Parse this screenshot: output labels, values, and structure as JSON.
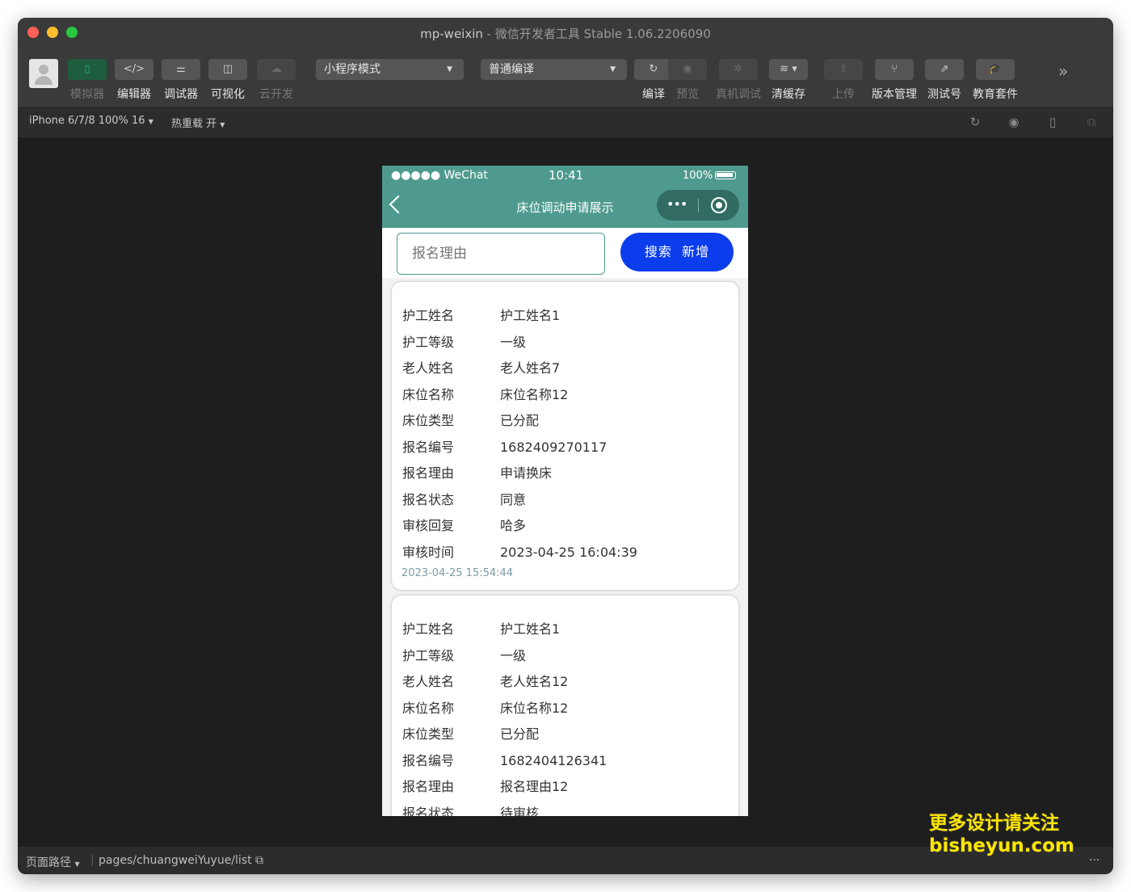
{
  "window": {
    "title_app": "mp-weixin",
    "title_rest": " - 微信开发者工具 Stable 1.06.2206090"
  },
  "toolbar": {
    "simulator": "模拟器",
    "editor": "编辑器",
    "debugger": "调试器",
    "visual": "可视化",
    "cloud": "云开发",
    "mode_select": "小程序模式",
    "compile_select": "普通编译",
    "compile": "编译",
    "preview": "预览",
    "device_debug": "真机调试",
    "clear_cache": "清缓存",
    "upload": "上传",
    "version": "版本管理",
    "test_account": "测试号",
    "edu": "教育套件"
  },
  "subbar": {
    "device": "iPhone 6/7/8 100% 16",
    "hot_reload": "热重载 开"
  },
  "phone": {
    "status_signal": "●●●●● WeChat",
    "status_time": "10:41",
    "status_battery": "100%",
    "nav_title": "床位调动申请展示",
    "capsule_dots": "•••",
    "search_placeholder": "报名理由",
    "search_label": "搜索",
    "add_label": "新增"
  },
  "cards": [
    {
      "rows": [
        {
          "k": "护工姓名",
          "v": "护工姓名1"
        },
        {
          "k": "护工等级",
          "v": "一级"
        },
        {
          "k": "老人姓名",
          "v": "老人姓名7"
        },
        {
          "k": "床位名称",
          "v": "床位名称12"
        },
        {
          "k": "床位类型",
          "v": "已分配"
        },
        {
          "k": "报名编号",
          "v": "1682409270117"
        },
        {
          "k": "报名理由",
          "v": "申请换床"
        },
        {
          "k": "报名状态",
          "v": "同意"
        },
        {
          "k": "审核回复",
          "v": "哈多"
        },
        {
          "k": "审核时间",
          "v": "2023-04-25 16:04:39"
        }
      ],
      "timestamp": "2023-04-25 15:54:44"
    },
    {
      "rows": [
        {
          "k": "护工姓名",
          "v": "护工姓名1"
        },
        {
          "k": "护工等级",
          "v": "一级"
        },
        {
          "k": "老人姓名",
          "v": "老人姓名12"
        },
        {
          "k": "床位名称",
          "v": "床位名称12"
        },
        {
          "k": "床位类型",
          "v": "已分配"
        },
        {
          "k": "报名编号",
          "v": "1682404126341"
        },
        {
          "k": "报名理由",
          "v": "报名理由12"
        },
        {
          "k": "报名状态",
          "v": "待审核"
        }
      ]
    }
  ],
  "bottombar": {
    "path_label": "页面路径",
    "path": "pages/chuangweiYuyue/list"
  },
  "watermark": {
    "line1": "更多设计请关注",
    "line2": "bisheyun.com"
  },
  "colors": {
    "accent": "#4f9a8e",
    "button": "#0c3ded"
  }
}
